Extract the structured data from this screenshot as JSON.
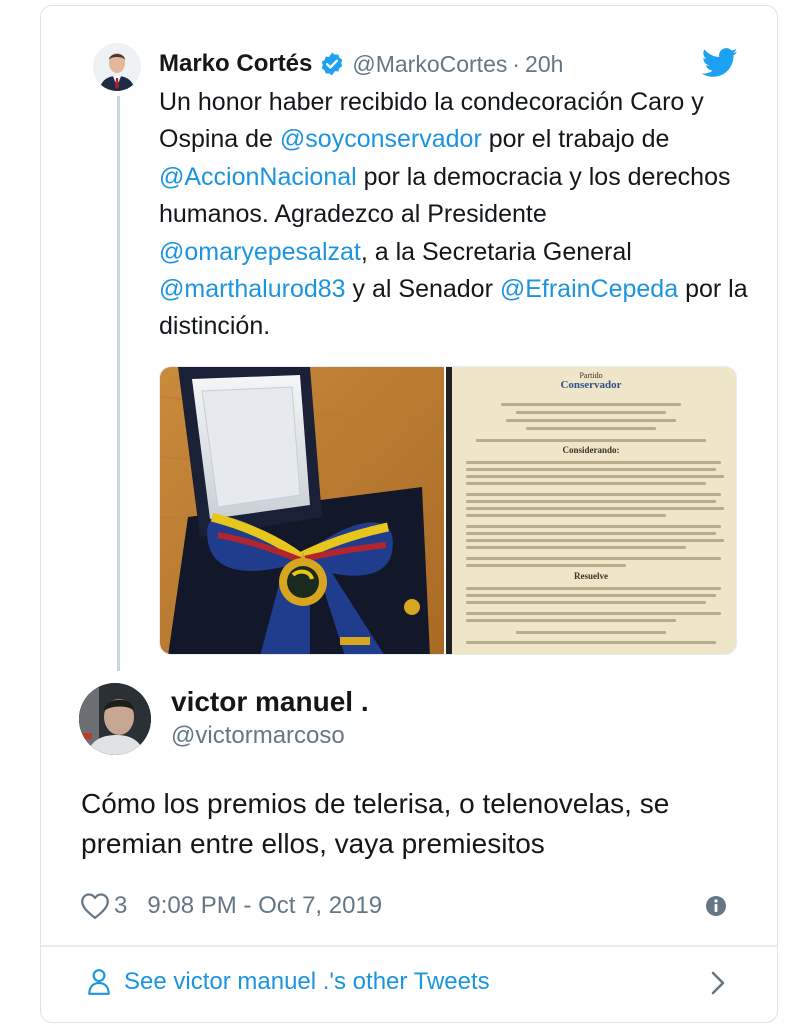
{
  "original_tweet": {
    "author_name": "Marko Cortés",
    "handle": "@MarkoCortes",
    "separator": "·",
    "time": "20h",
    "text_segments": [
      {
        "text": "Un honor haber recibido la condecoración Caro y Ospina de ",
        "mention": false
      },
      {
        "text": "@soyconservador",
        "mention": true
      },
      {
        "text": " por el trabajo de ",
        "mention": false
      },
      {
        "text": "@AccionNacional",
        "mention": true
      },
      {
        "text": " por la democracia y los derechos humanos. Agradezco al Presidente ",
        "mention": false
      },
      {
        "text": "@omaryepesalzat",
        "mention": true
      },
      {
        "text": ", a la Secretaria General ",
        "mention": false
      },
      {
        "text": "@marthalurod83",
        "mention": true
      },
      {
        "text": " y al Senador ",
        "mention": false
      },
      {
        "text": "@EfrainCepeda",
        "mention": true
      },
      {
        "text": " por la distinción.",
        "mention": false
      }
    ],
    "media": {
      "left_image": "medal-in-box-photo",
      "right_image": "resolution-document-photo",
      "document_logo_small": "Partido",
      "document_logo": "Conservador",
      "document_heading": "Considerando:",
      "document_subheading": "Resuelve"
    }
  },
  "reply": {
    "author_name": "victor manuel .",
    "handle": "@victormarcoso",
    "text": "Cómo los premios de telerisa, o telenovelas, se premian entre ellos, vaya premiesitos",
    "like_count": "3",
    "timestamp": "9:08 PM - Oct 7, 2019"
  },
  "footer": {
    "link_label": "See victor manuel .'s other Tweets"
  },
  "icons": {
    "verified": "verified-badge-icon",
    "brand": "twitter-bird-icon",
    "like": "heart-icon",
    "info": "info-icon",
    "profile": "person-icon",
    "next": "chevron-right-icon"
  },
  "colors": {
    "link": "#1b95e0",
    "secondary_text": "#657786",
    "primary_text": "#14171a",
    "border": "#e6ecf0"
  }
}
